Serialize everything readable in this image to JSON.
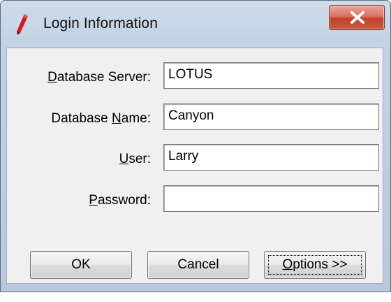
{
  "window": {
    "title": "Login Information",
    "app_icon": "red-pen-icon",
    "close_icon": "close-x-icon"
  },
  "form": {
    "server": {
      "label_pre": "",
      "label_key": "D",
      "label_post": "atabase Server:",
      "value": "LOTUS"
    },
    "name": {
      "label_pre": "Database ",
      "label_key": "N",
      "label_post": "ame:",
      "value": "Canyon"
    },
    "user": {
      "label_pre": "",
      "label_key": "U",
      "label_post": "ser:",
      "value": "Larry"
    },
    "password": {
      "label_pre": "",
      "label_key": "P",
      "label_post": "assword:",
      "value": ""
    }
  },
  "buttons": {
    "ok": "OK",
    "cancel": "Cancel",
    "options_key": "O",
    "options_rest": "ptions >>"
  },
  "colors": {
    "titlebar": "#c3d2e4",
    "close": "#c1412a",
    "client": "#f0f0f0"
  }
}
